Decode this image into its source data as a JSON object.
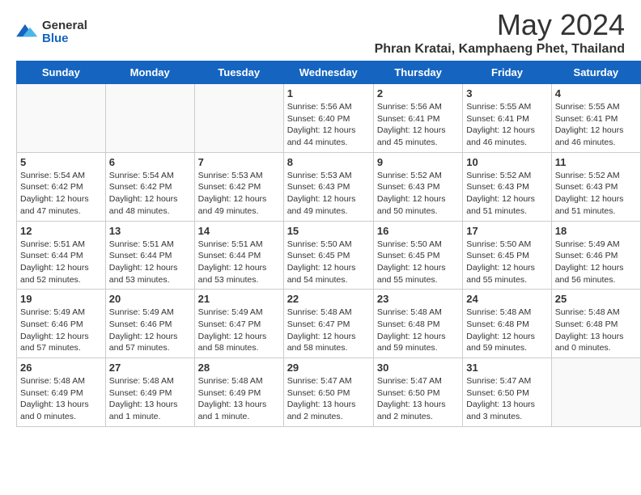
{
  "header": {
    "logo_general": "General",
    "logo_blue": "Blue",
    "month_title": "May 2024",
    "location": "Phran Kratai, Kamphaeng Phet, Thailand"
  },
  "weekdays": [
    "Sunday",
    "Monday",
    "Tuesday",
    "Wednesday",
    "Thursday",
    "Friday",
    "Saturday"
  ],
  "weeks": [
    [
      {
        "day": "",
        "info": ""
      },
      {
        "day": "",
        "info": ""
      },
      {
        "day": "",
        "info": ""
      },
      {
        "day": "1",
        "info": "Sunrise: 5:56 AM\nSunset: 6:40 PM\nDaylight: 12 hours\nand 44 minutes."
      },
      {
        "day": "2",
        "info": "Sunrise: 5:56 AM\nSunset: 6:41 PM\nDaylight: 12 hours\nand 45 minutes."
      },
      {
        "day": "3",
        "info": "Sunrise: 5:55 AM\nSunset: 6:41 PM\nDaylight: 12 hours\nand 46 minutes."
      },
      {
        "day": "4",
        "info": "Sunrise: 5:55 AM\nSunset: 6:41 PM\nDaylight: 12 hours\nand 46 minutes."
      }
    ],
    [
      {
        "day": "5",
        "info": "Sunrise: 5:54 AM\nSunset: 6:42 PM\nDaylight: 12 hours\nand 47 minutes."
      },
      {
        "day": "6",
        "info": "Sunrise: 5:54 AM\nSunset: 6:42 PM\nDaylight: 12 hours\nand 48 minutes."
      },
      {
        "day": "7",
        "info": "Sunrise: 5:53 AM\nSunset: 6:42 PM\nDaylight: 12 hours\nand 49 minutes."
      },
      {
        "day": "8",
        "info": "Sunrise: 5:53 AM\nSunset: 6:43 PM\nDaylight: 12 hours\nand 49 minutes."
      },
      {
        "day": "9",
        "info": "Sunrise: 5:52 AM\nSunset: 6:43 PM\nDaylight: 12 hours\nand 50 minutes."
      },
      {
        "day": "10",
        "info": "Sunrise: 5:52 AM\nSunset: 6:43 PM\nDaylight: 12 hours\nand 51 minutes."
      },
      {
        "day": "11",
        "info": "Sunrise: 5:52 AM\nSunset: 6:43 PM\nDaylight: 12 hours\nand 51 minutes."
      }
    ],
    [
      {
        "day": "12",
        "info": "Sunrise: 5:51 AM\nSunset: 6:44 PM\nDaylight: 12 hours\nand 52 minutes."
      },
      {
        "day": "13",
        "info": "Sunrise: 5:51 AM\nSunset: 6:44 PM\nDaylight: 12 hours\nand 53 minutes."
      },
      {
        "day": "14",
        "info": "Sunrise: 5:51 AM\nSunset: 6:44 PM\nDaylight: 12 hours\nand 53 minutes."
      },
      {
        "day": "15",
        "info": "Sunrise: 5:50 AM\nSunset: 6:45 PM\nDaylight: 12 hours\nand 54 minutes."
      },
      {
        "day": "16",
        "info": "Sunrise: 5:50 AM\nSunset: 6:45 PM\nDaylight: 12 hours\nand 55 minutes."
      },
      {
        "day": "17",
        "info": "Sunrise: 5:50 AM\nSunset: 6:45 PM\nDaylight: 12 hours\nand 55 minutes."
      },
      {
        "day": "18",
        "info": "Sunrise: 5:49 AM\nSunset: 6:46 PM\nDaylight: 12 hours\nand 56 minutes."
      }
    ],
    [
      {
        "day": "19",
        "info": "Sunrise: 5:49 AM\nSunset: 6:46 PM\nDaylight: 12 hours\nand 57 minutes."
      },
      {
        "day": "20",
        "info": "Sunrise: 5:49 AM\nSunset: 6:46 PM\nDaylight: 12 hours\nand 57 minutes."
      },
      {
        "day": "21",
        "info": "Sunrise: 5:49 AM\nSunset: 6:47 PM\nDaylight: 12 hours\nand 58 minutes."
      },
      {
        "day": "22",
        "info": "Sunrise: 5:48 AM\nSunset: 6:47 PM\nDaylight: 12 hours\nand 58 minutes."
      },
      {
        "day": "23",
        "info": "Sunrise: 5:48 AM\nSunset: 6:48 PM\nDaylight: 12 hours\nand 59 minutes."
      },
      {
        "day": "24",
        "info": "Sunrise: 5:48 AM\nSunset: 6:48 PM\nDaylight: 12 hours\nand 59 minutes."
      },
      {
        "day": "25",
        "info": "Sunrise: 5:48 AM\nSunset: 6:48 PM\nDaylight: 13 hours\nand 0 minutes."
      }
    ],
    [
      {
        "day": "26",
        "info": "Sunrise: 5:48 AM\nSunset: 6:49 PM\nDaylight: 13 hours\nand 0 minutes."
      },
      {
        "day": "27",
        "info": "Sunrise: 5:48 AM\nSunset: 6:49 PM\nDaylight: 13 hours\nand 1 minute."
      },
      {
        "day": "28",
        "info": "Sunrise: 5:48 AM\nSunset: 6:49 PM\nDaylight: 13 hours\nand 1 minute."
      },
      {
        "day": "29",
        "info": "Sunrise: 5:47 AM\nSunset: 6:50 PM\nDaylight: 13 hours\nand 2 minutes."
      },
      {
        "day": "30",
        "info": "Sunrise: 5:47 AM\nSunset: 6:50 PM\nDaylight: 13 hours\nand 2 minutes."
      },
      {
        "day": "31",
        "info": "Sunrise: 5:47 AM\nSunset: 6:50 PM\nDaylight: 13 hours\nand 3 minutes."
      },
      {
        "day": "",
        "info": ""
      }
    ]
  ]
}
